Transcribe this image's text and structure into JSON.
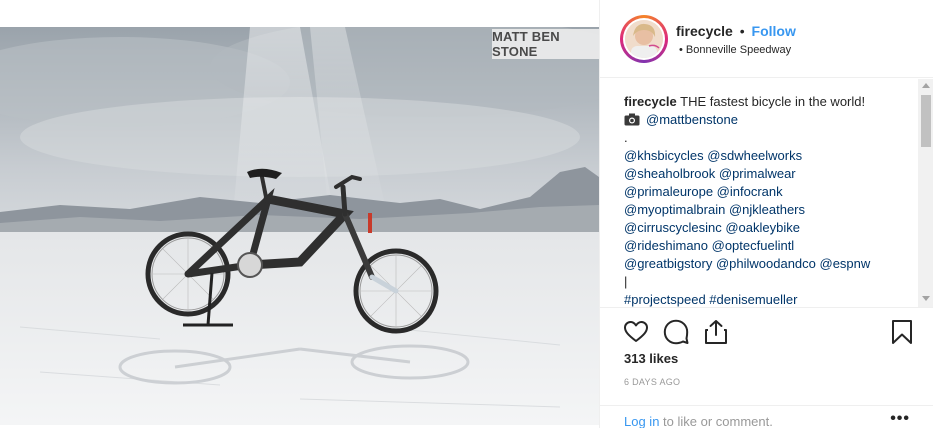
{
  "photo": {
    "watermark": "MATT BEN STONE",
    "alt_subject": "bicycle on salt flats"
  },
  "header": {
    "username": "firecycle",
    "separator": "•",
    "follow_label": "Follow",
    "location_bullet": "•",
    "location": "Bonneville Speedway"
  },
  "caption": {
    "username": "firecycle",
    "text": "THE fastest bicycle in the world!",
    "photo_credit": "@mattbenstone",
    "spacer": ".",
    "mentions": [
      "@khsbicycles @sdwheelworks",
      "@sheaholbrook @primalwear",
      "@primaleurope @infocrank",
      "@myoptimalbrain @njkleathers",
      "@cirruscyclesinc @oakleybike",
      "@rideshimano @optecfuelintl",
      "@greatbigstory @philwoodandco @espnw"
    ],
    "pipe": "|",
    "hashtags": "#projectspeed #denisemueller"
  },
  "actions": {
    "like_icon": "heart-icon",
    "comment_icon": "comment-icon",
    "share_icon": "share-icon",
    "save_icon": "bookmark-icon"
  },
  "likes": "313 likes",
  "timestamp": "6 DAYS AGO",
  "footer": {
    "login_label": "Log in",
    "login_suffix": " to like or comment.",
    "more_label": "•••"
  },
  "colors": {
    "link_blue": "#3897f0",
    "mention_dark_blue": "#003569",
    "muted_gray": "#999999",
    "text": "#262626"
  }
}
